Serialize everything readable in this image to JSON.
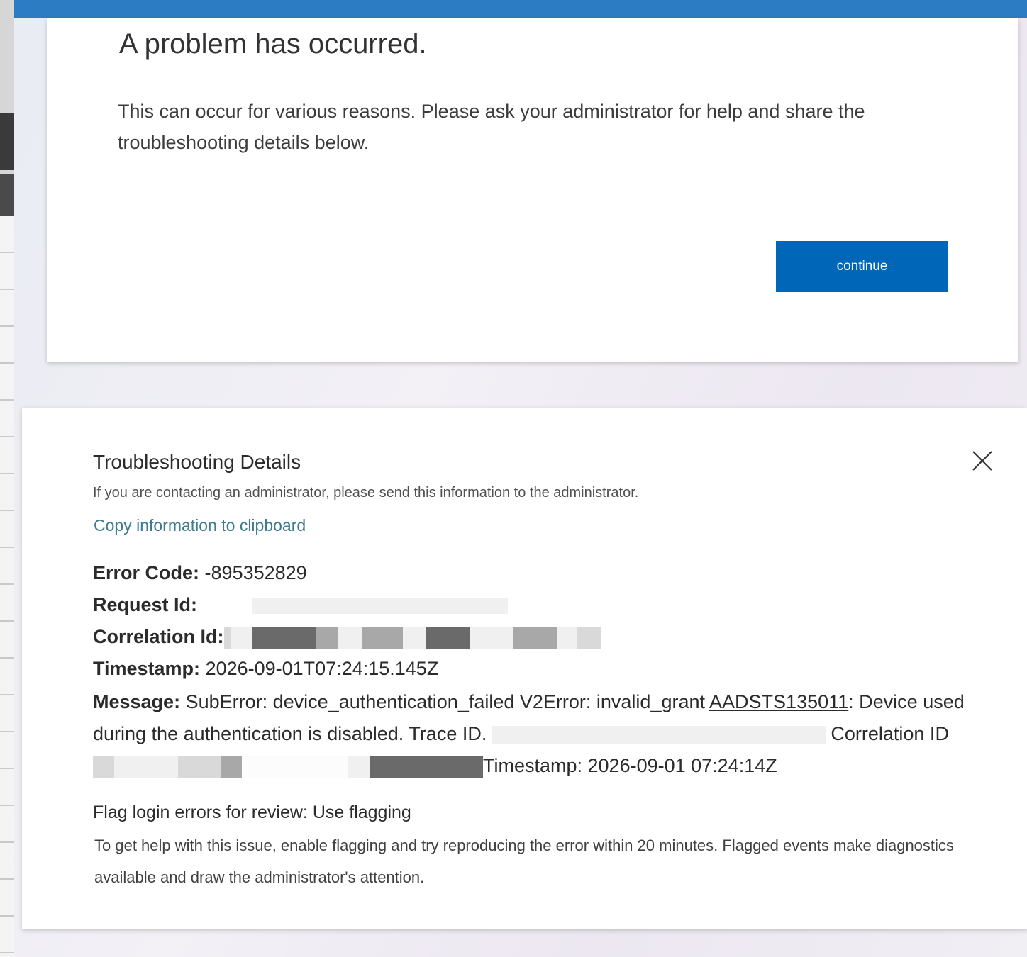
{
  "error_page": {
    "title": "A problem has occurred.",
    "description": "This can occur for various reasons. Please ask your administrator for help and share the troubleshooting details below.",
    "continue_label": "continue"
  },
  "troubleshooting": {
    "heading": "Troubleshooting Details",
    "subtitle": "If you are contacting an administrator, please send this information to the administrator.",
    "copy_link": "Copy information to clipboard",
    "error_code_label": "Error Code:",
    "error_code_value": "-895352829",
    "request_id_label": "Request Id:",
    "correlation_id_label": "Correlation Id:",
    "timestamp_label": "Timestamp:",
    "timestamp_value": "2026-09-01T07:24:15.145Z",
    "message_label": "Message:",
    "message_part1": "SubError: device_authentication_failed V2Error: invalid_grant ",
    "message_aadsts": "AADSTS135011",
    "message_part2": ": Device used during the authentication is disabled. Trace ID.",
    "message_correlation": "Correlation ID",
    "message_timestamp": "Timestamp: 2026-09-01 07:24:14Z",
    "flag_title": "Flag login errors for review: Use flagging",
    "flag_description": "To get help with this issue, enable flagging and try reproducing the error within 20 minutes. Flagged events make diagnostics available and draw the administrator's attention."
  },
  "icons": {
    "close": "close-icon"
  },
  "colors": {
    "accent": "#0067b8",
    "top_bar": "#2b7cc2",
    "link": "#3c7a90"
  }
}
